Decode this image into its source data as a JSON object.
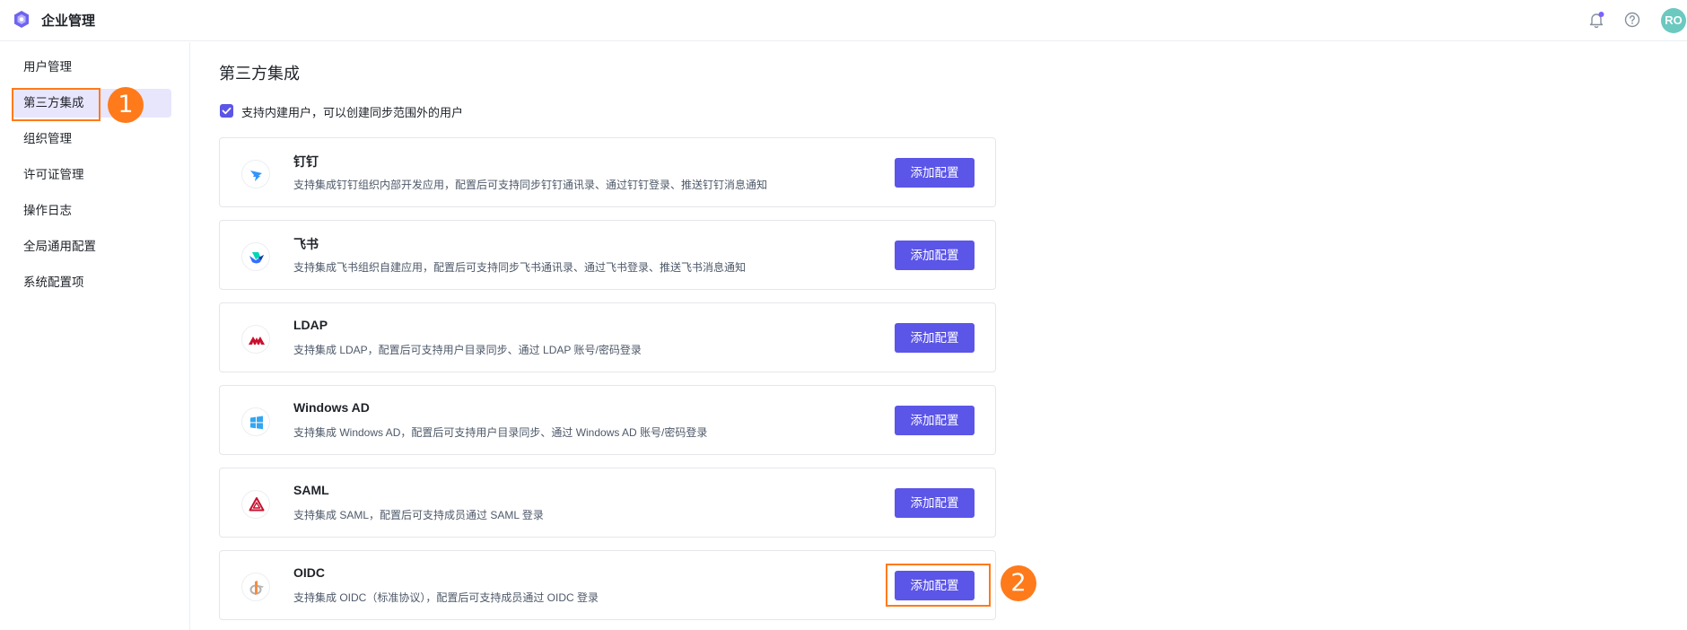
{
  "header": {
    "title": "企业管理",
    "avatar_text": "RO",
    "notification_dot_color": "#7b61ff"
  },
  "sidebar": {
    "items": [
      {
        "label": "用户管理"
      },
      {
        "label": "第三方集成",
        "active": true
      },
      {
        "label": "组织管理"
      },
      {
        "label": "许可证管理"
      },
      {
        "label": "操作日志"
      },
      {
        "label": "全局通用配置"
      },
      {
        "label": "系统配置项"
      }
    ]
  },
  "main": {
    "title": "第三方集成",
    "checkbox": {
      "label": "支持内建用户，可以创建同步范围外的用户",
      "checked": true
    },
    "integrations": [
      {
        "name": "钉钉",
        "desc": "支持集成钉钉组织内部开发应用，配置后可支持同步钉钉通讯录、通过钉钉登录、推送钉钉消息通知",
        "button": "添加配置",
        "icon": "dingtalk-icon"
      },
      {
        "name": "飞书",
        "desc": "支持集成飞书组织自建应用，配置后可支持同步飞书通讯录、通过飞书登录、推送飞书消息通知",
        "button": "添加配置",
        "icon": "feishu-icon"
      },
      {
        "name": "LDAP",
        "desc": "支持集成 LDAP，配置后可支持用户目录同步、通过 LDAP 账号/密码登录",
        "button": "添加配置",
        "icon": "ldap-icon"
      },
      {
        "name": "Windows AD",
        "desc": "支持集成 Windows AD，配置后可支持用户目录同步、通过 Windows AD 账号/密码登录",
        "button": "添加配置",
        "icon": "windows-icon"
      },
      {
        "name": "SAML",
        "desc": "支持集成 SAML，配置后可支持成员通过 SAML 登录",
        "button": "添加配置",
        "icon": "saml-icon"
      },
      {
        "name": "OIDC",
        "desc": "支持集成 OIDC（标准协议），配置后可支持成员通过 OIDC 登录",
        "button": "添加配置",
        "icon": "oidc-icon"
      }
    ]
  },
  "annotations": {
    "marker_1": "1",
    "marker_2": "2",
    "color": "#ff7a1a"
  }
}
